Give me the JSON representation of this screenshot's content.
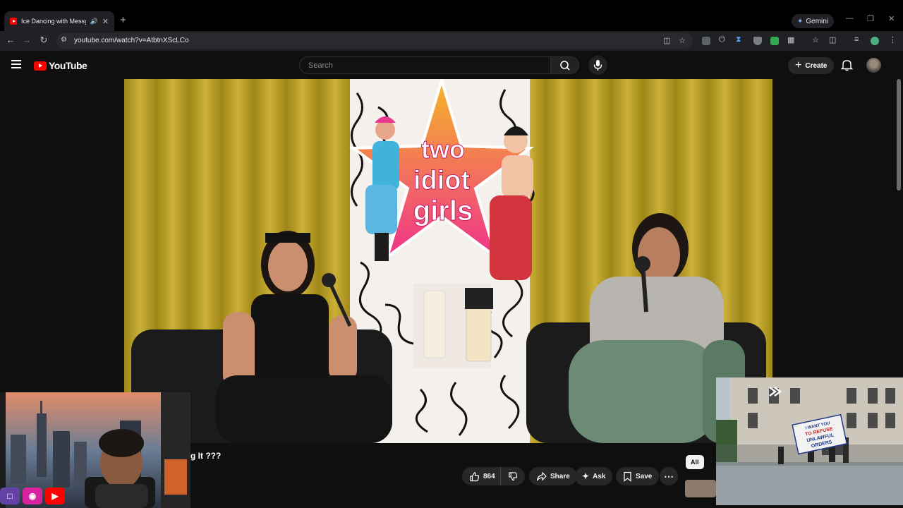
{
  "browser": {
    "tab_title": "Ice Dancing with Messy Bun",
    "new_tab_glyph": "+",
    "gemini_label": "Gemini",
    "url": "youtube.com/watch?v=AtbtnXScLCo"
  },
  "youtube": {
    "logo_text": "YouTube",
    "search_placeholder": "Search",
    "create_label": "Create"
  },
  "video": {
    "title_visible": "g It ???",
    "set_sign": {
      "line1": "two",
      "line2": "idiot",
      "line3": "girls"
    },
    "likes": "864",
    "share_label": "Share",
    "ask_label": "Ask",
    "save_label": "Save",
    "chip_all": "All"
  },
  "overlay": {
    "banner_line1": "I WANT YOU",
    "banner_line2": "TO REFUSE",
    "banner_line3": "UNLAWFUL",
    "banner_line4": "ORDERS"
  },
  "icons": [
    "speaker-icon",
    "close-icon",
    "back-icon",
    "forward-icon",
    "reload-icon",
    "site-settings-icon",
    "install-icon",
    "bookmark-star-icon",
    "menu-icon",
    "search-icon",
    "mic-icon",
    "bell-icon",
    "like-icon",
    "dislike-icon",
    "share-icon",
    "ask-icon",
    "save-icon",
    "more-icon"
  ],
  "colors": {
    "youtube_red": "#ff0000",
    "bg": "#0f0f0f",
    "curtain": "#c7ab2c",
    "pill": "#272727"
  }
}
